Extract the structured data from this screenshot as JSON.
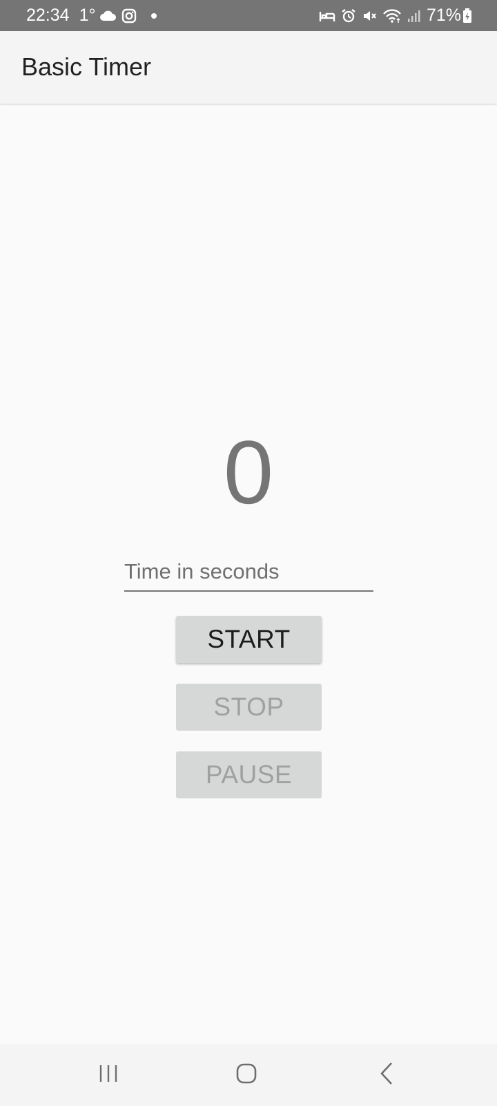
{
  "status_bar": {
    "time": "22:34",
    "temperature": "1°",
    "battery": "71%",
    "icons_left": [
      "cloud-icon",
      "instagram-icon",
      "dot-icon"
    ],
    "icons_right": [
      "sleep-mode-icon",
      "alarm-icon",
      "mute-icon",
      "wifi-icon",
      "signal-icon",
      "battery-charging-icon"
    ]
  },
  "app_bar": {
    "title": "Basic Timer"
  },
  "timer": {
    "value": "0"
  },
  "input": {
    "placeholder": "Time in seconds",
    "value": ""
  },
  "buttons": {
    "start": "START",
    "stop": "STOP",
    "pause": "PAUSE"
  },
  "nav_bar": {
    "items": [
      "recents-icon",
      "home-icon",
      "back-icon"
    ]
  },
  "colors": {
    "status_bar_bg": "#757575",
    "app_bar_bg": "#f4f4f4",
    "background": "#fafafa",
    "button_bg": "#d6d7d7",
    "button_enabled_text": "#1b1b1b",
    "button_disabled_text": "#a0a0a0",
    "timer_text": "#757575"
  }
}
